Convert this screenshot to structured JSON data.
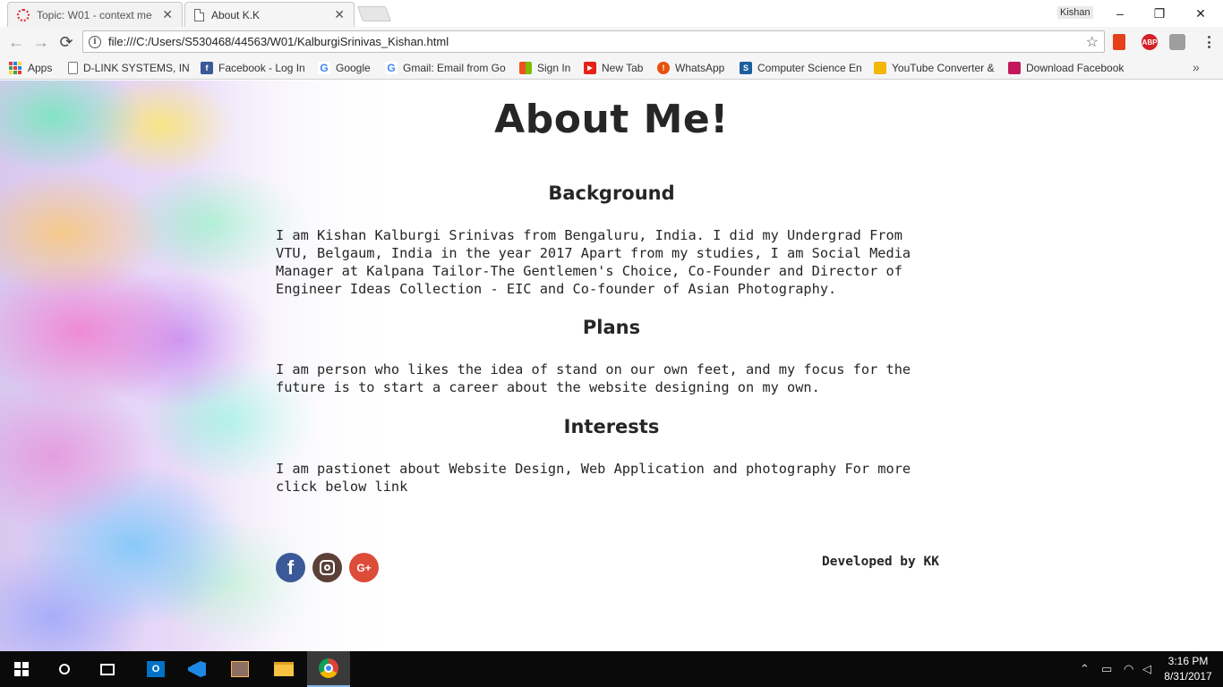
{
  "window": {
    "tabs": [
      {
        "title": "Topic: W01 - context me",
        "active": false,
        "icon": "loading-ring-icon"
      },
      {
        "title": "About K.K",
        "active": true,
        "icon": "document-icon"
      }
    ],
    "profile_name": "Kishan",
    "controls": {
      "minimize": "–",
      "restore": "❐",
      "close": "✕"
    }
  },
  "toolbar": {
    "url": "file:///C:/Users/S530468/44563/W01/KalburgiSrinivas_Kishan.html",
    "back": "←",
    "forward": "→",
    "reload": "⟳",
    "info": "i",
    "star": "☆",
    "extensions": [
      {
        "name": "office-icon",
        "label": "",
        "color": "#e5401a"
      },
      {
        "name": "adblock-plus-icon",
        "label": "ABP",
        "color": "#d61f26"
      },
      {
        "name": "pdf-icon",
        "label": "",
        "color": "#9e9e9e"
      }
    ]
  },
  "bookmarks": {
    "items": [
      {
        "label": "Apps",
        "icon": "apps-grid-icon"
      },
      {
        "label": "D-LINK SYSTEMS, INC",
        "icon": "page-icon"
      },
      {
        "label": "Facebook - Log In",
        "icon": "facebook-icon"
      },
      {
        "label": "Google",
        "icon": "google-icon"
      },
      {
        "label": "Gmail: Email from Go",
        "icon": "google-icon"
      },
      {
        "label": "Sign In",
        "icon": "microsoft-icon"
      },
      {
        "label": "New Tab",
        "icon": "youtube-icon"
      },
      {
        "label": "WhatsApp",
        "icon": "alert-icon"
      },
      {
        "label": "Computer Science En",
        "icon": "s-icon"
      },
      {
        "label": "YouTube Converter &",
        "icon": "converter-icon"
      },
      {
        "label": "Download Facebook",
        "icon": "download-icon"
      }
    ],
    "more": "»"
  },
  "page": {
    "title": "About Me!",
    "sections": [
      {
        "heading": "Background",
        "lines": [
          "I am Kishan Kalburgi Srinivas from Bengaluru, India. I did my Undergrad From",
          "VTU, Belgaum, India in the year 2017 Apart from my studies, I am Social Media",
          "Manager at Kalpana Tailor-The Gentlemen's Choice, Co-Founder and Director of",
          "Engineer Ideas Collection - EIC and Co-founder of Asian Photography."
        ]
      },
      {
        "heading": "Plans",
        "lines": [
          "I am person who likes the idea of stand on our own feet, and my focus for the",
          "future is to start a career about the website designing on my own."
        ]
      },
      {
        "heading": "Interests",
        "lines": [
          "I am pastionet about Website Design, Web Application and photography For more",
          "click below link"
        ]
      }
    ],
    "social": [
      {
        "name": "facebook-icon",
        "glyph": "f",
        "color": "#3b5998"
      },
      {
        "name": "instagram-icon",
        "glyph": "",
        "color": "#5b4037"
      },
      {
        "name": "google-plus-icon",
        "glyph": "G+",
        "color": "#dd4b39"
      }
    ],
    "credit": "Developed by KK"
  },
  "taskbar": {
    "apps": [
      {
        "name": "start-icon",
        "active": false
      },
      {
        "name": "search-icon",
        "active": false
      },
      {
        "name": "task-view-icon",
        "active": false
      },
      {
        "name": "outlook-icon",
        "active": false
      },
      {
        "name": "visual-studio-icon",
        "active": false
      },
      {
        "name": "app-icon",
        "active": false
      },
      {
        "name": "file-explorer-icon",
        "active": false
      },
      {
        "name": "chrome-icon",
        "active": true
      }
    ],
    "time": "3:16 PM",
    "date": "8/31/2017"
  }
}
